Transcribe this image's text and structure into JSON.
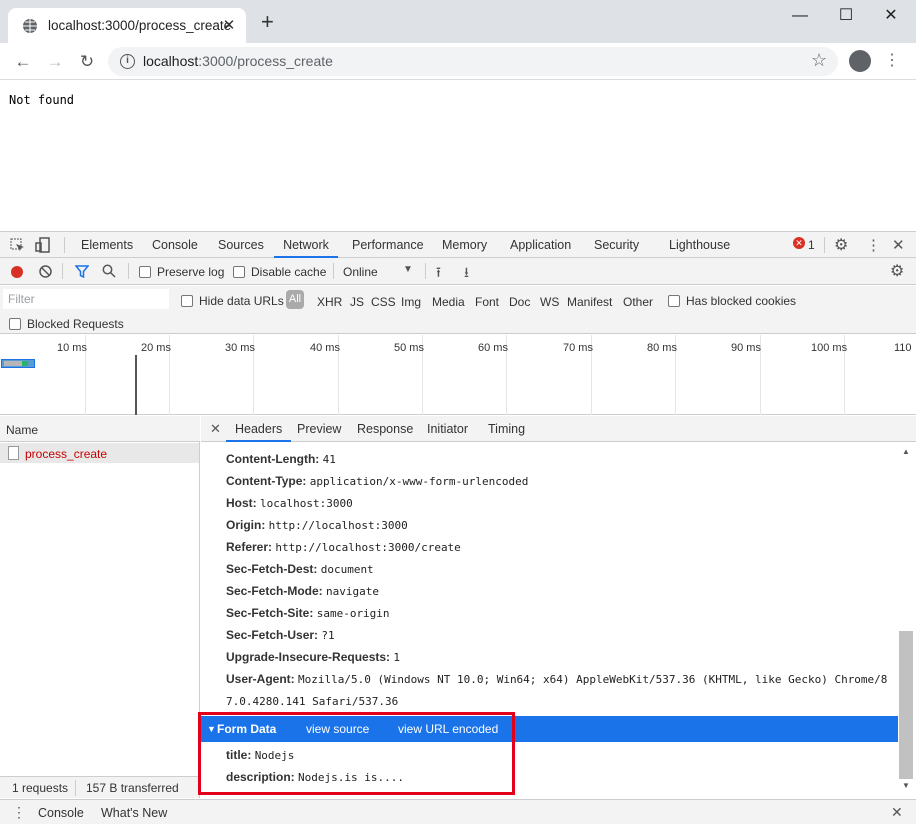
{
  "browser": {
    "tab_title": "localhost:3000/process_create",
    "url_host": "localhost",
    "url_rest": ":3000/process_create",
    "page_text": "Not found"
  },
  "devtools": {
    "tabs": [
      "Elements",
      "Console",
      "Sources",
      "Network",
      "Performance",
      "Memory",
      "Application",
      "Security",
      "Lighthouse"
    ],
    "active_tab": "Network",
    "error_count": "1",
    "toolbar": {
      "preserve_log": "Preserve log",
      "disable_cache": "Disable cache",
      "throttle": "Online"
    },
    "filter": {
      "placeholder": "Filter",
      "hide_data_urls": "Hide data URLs",
      "types": [
        "All",
        "XHR",
        "JS",
        "CSS",
        "Img",
        "Media",
        "Font",
        "Doc",
        "WS",
        "Manifest",
        "Other"
      ],
      "has_blocked_cookies": "Has blocked cookies",
      "blocked_requests": "Blocked Requests"
    },
    "timeline_ticks": [
      "10 ms",
      "20 ms",
      "30 ms",
      "40 ms",
      "50 ms",
      "60 ms",
      "70 ms",
      "80 ms",
      "90 ms",
      "100 ms",
      "110"
    ],
    "name_header": "Name",
    "request_name": "process_create",
    "detail_tabs": [
      "Headers",
      "Preview",
      "Response",
      "Initiator",
      "Timing"
    ],
    "active_detail_tab": "Headers",
    "request_headers": [
      {
        "name": "Content-Length:",
        "value": "41"
      },
      {
        "name": "Content-Type:",
        "value": "application/x-www-form-urlencoded"
      },
      {
        "name": "Host:",
        "value": "localhost:3000"
      },
      {
        "name": "Origin:",
        "value": "http://localhost:3000"
      },
      {
        "name": "Referer:",
        "value": "http://localhost:3000/create"
      },
      {
        "name": "Sec-Fetch-Dest:",
        "value": "document"
      },
      {
        "name": "Sec-Fetch-Mode:",
        "value": "navigate"
      },
      {
        "name": "Sec-Fetch-Site:",
        "value": "same-origin"
      },
      {
        "name": "Sec-Fetch-User:",
        "value": "?1"
      },
      {
        "name": "Upgrade-Insecure-Requests:",
        "value": "1"
      },
      {
        "name": "User-Agent:",
        "value": "Mozilla/5.0 (Windows NT 10.0; Win64; x64) AppleWebKit/537.36 (KHTML, like Gecko) Chrome/8"
      }
    ],
    "user_agent_cont": "7.0.4280.141 Safari/537.36",
    "form_data": {
      "title": "Form Data",
      "view_source": "view source",
      "view_url_encoded": "view URL encoded",
      "fields": [
        {
          "name": "title:",
          "value": "Nodejs"
        },
        {
          "name": "description:",
          "value": "Nodejs.is is...."
        }
      ]
    },
    "status": {
      "requests": "1 requests",
      "transferred": "157 B transferred"
    },
    "drawer_tabs": [
      "Console",
      "What's New"
    ]
  }
}
